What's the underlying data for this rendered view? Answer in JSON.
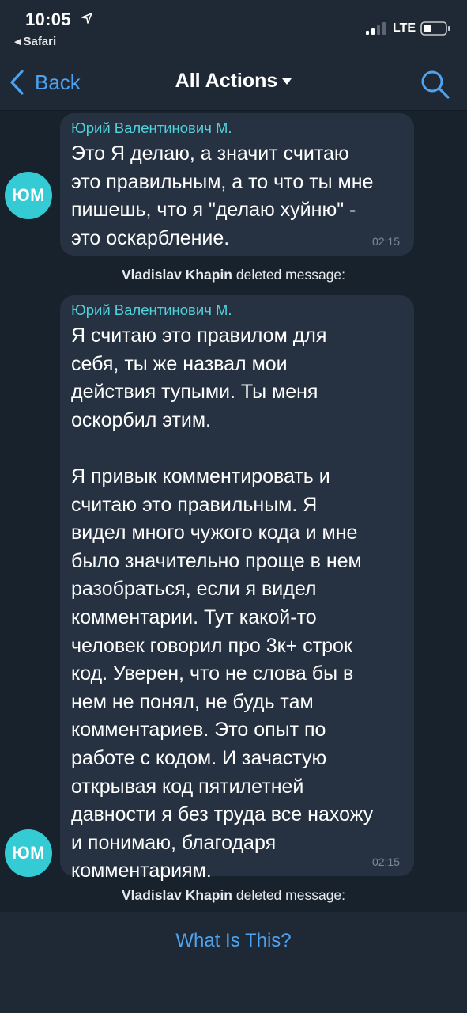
{
  "status_bar": {
    "time": "10:05",
    "back_app": "Safari",
    "network": "LTE"
  },
  "nav": {
    "back_label": "Back",
    "title": "All Actions"
  },
  "messages": [
    {
      "sender": "Юрий Валентинович М.",
      "avatar_initials": "ЮМ",
      "text": "Это Я делаю, а значит считаю\nэто правильным, а то что ты мне\nпишешь, что я \"делаю хуйню\" -\nэто оскарбление.",
      "time": "02:15"
    },
    {
      "sender": "Юрий Валентинович М.",
      "avatar_initials": "ЮМ",
      "text": "Я считаю это правилом для\nсебя, ты же назвал мои\nдействия тупыми. Ты меня\nоскорбил этим.\n\nЯ привык комментировать и\nсчитаю это правильным. Я\nвидел много чужого кода и мне\nбыло значительно проще в нем\nразобраться, если я видел\nкомментарии. Тут какой-то\nчеловек говорил про 3к+ строк\nкод. Уверен, что не слова бы в\nнем не понял, не будь там\nкомментариев. Это опыт по\nработе с кодом. И зачастую\nоткрывая код пятилетней\nдавности я без труда все нахожу\nи понимаю, благодаря\nкомментариям.",
      "time": "02:15"
    }
  ],
  "service_messages": [
    {
      "actor": "Vladislav Khapin",
      "action": "deleted message:"
    },
    {
      "actor": "Vladislav Khapin",
      "action": "deleted message:"
    }
  ],
  "footer": {
    "link_label": "What Is This?"
  },
  "colors": {
    "background": "#18222d",
    "bar": "#1f2936",
    "bubble": "#263241",
    "accent_blue": "#4da3ef",
    "sender_teal": "#4fd3dc",
    "avatar": "#35cbd4"
  },
  "icons": [
    "location-arrow-icon",
    "signal-icon",
    "battery-icon",
    "chevron-left-icon",
    "caret-down-icon",
    "search-icon"
  ]
}
